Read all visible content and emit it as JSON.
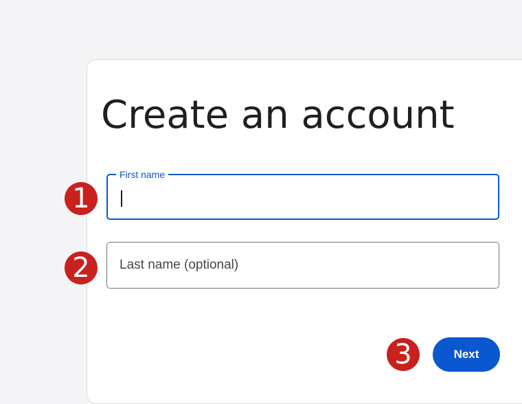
{
  "page": {
    "title": "Create an account"
  },
  "form": {
    "first_name": {
      "label": "First name",
      "value": ""
    },
    "last_name": {
      "placeholder": "Last name (optional)",
      "value": ""
    },
    "next_label": "Next"
  },
  "annotations": {
    "first_name_marker": "1",
    "last_name_marker": "2",
    "next_marker": "3"
  },
  "colors": {
    "page_background": "#f4f4f6",
    "accent": "#0b57d0",
    "marker": "#c9211e",
    "outline": "#747775"
  }
}
